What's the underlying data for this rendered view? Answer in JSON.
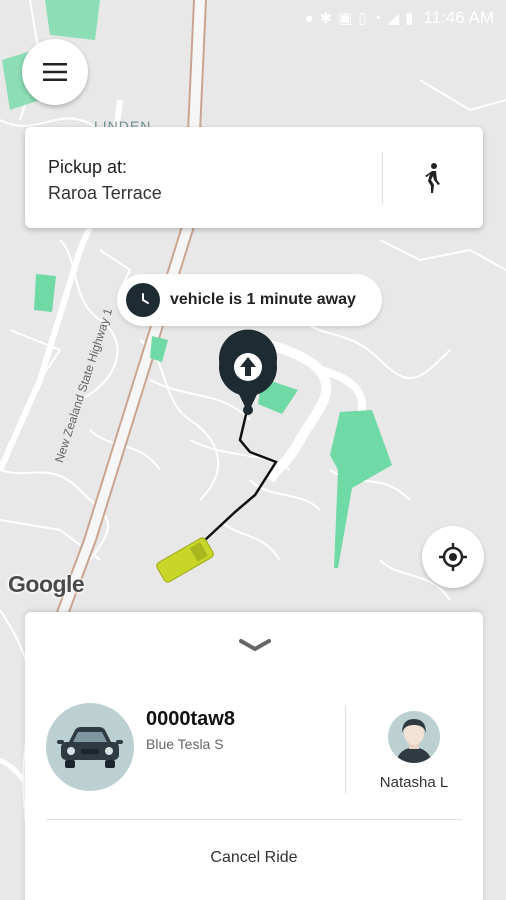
{
  "status_bar": {
    "time": "11:46 AM",
    "icons": [
      "location-icon",
      "bluetooth-icon",
      "nfc-icon",
      "vibrate-icon",
      "wifi-icon",
      "signal-icon",
      "battery-icon"
    ]
  },
  "map": {
    "area_label": "LINDEN",
    "road_label": "New Zealand State Highway 1",
    "attribution": "Google"
  },
  "pickup": {
    "label": "Pickup at:",
    "value": "Raroa Terrace"
  },
  "eta": {
    "text": "vehicle is 1 minute away"
  },
  "vehicle": {
    "plate": "0000taw8",
    "model": "Blue Tesla S"
  },
  "driver": {
    "name": "Natasha L"
  },
  "actions": {
    "cancel_label": "Cancel Ride"
  },
  "colors": {
    "accent_dark": "#1e2b33",
    "park_green": "#6fdaa6",
    "vehicle_yellow": "#c8d62a",
    "avatar_bg": "#bcd0d2"
  }
}
